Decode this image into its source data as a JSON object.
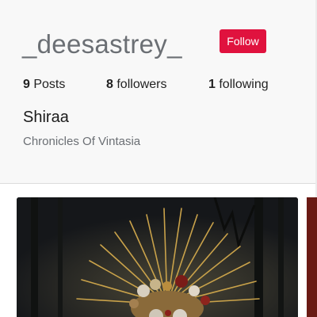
{
  "profile": {
    "username": "_deesastrey_",
    "follow_label": "Follow",
    "display_name": "Shiraa",
    "bio": "Chronicles Of Vintasia"
  },
  "stats": {
    "posts_count": "9",
    "posts_label": "Posts",
    "followers_count": "8",
    "followers_label": "followers",
    "following_count": "1",
    "following_label": "following"
  },
  "colors": {
    "follow_button": "#e0123e",
    "header_background": "#f8f8f8",
    "muted_text": "#6b6f74"
  }
}
